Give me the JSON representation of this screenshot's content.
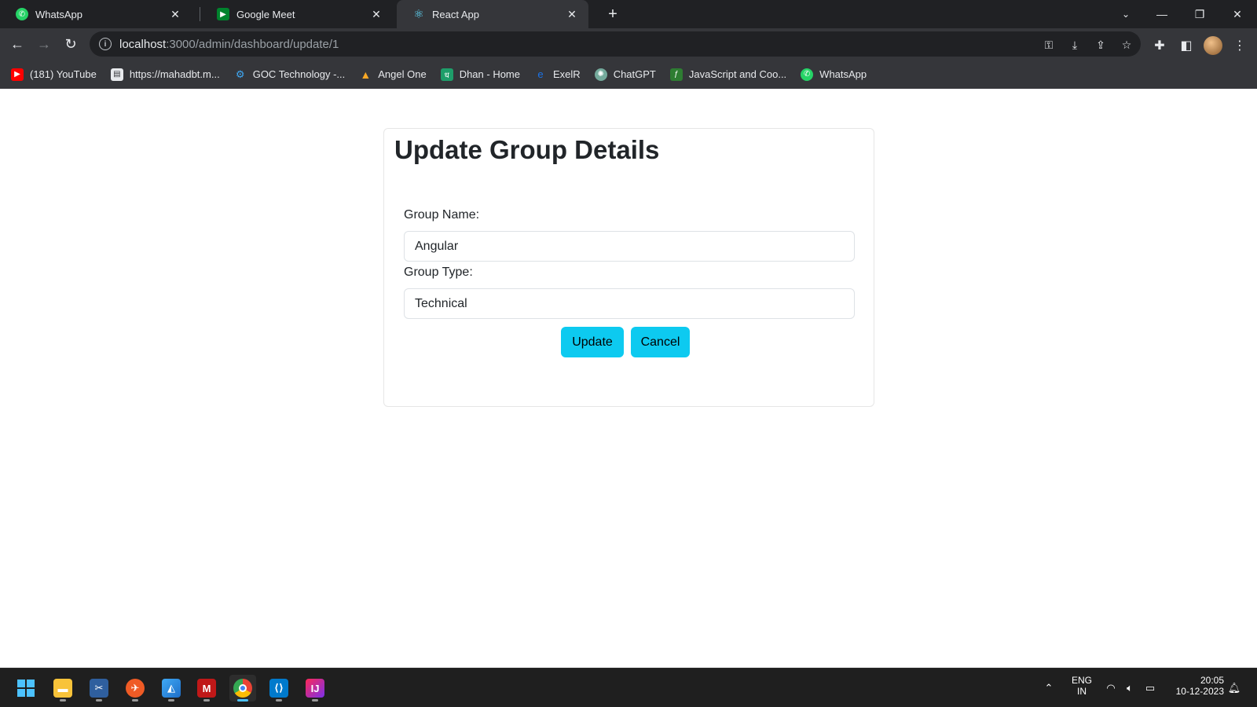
{
  "browser": {
    "tabs": [
      {
        "label": "WhatsApp",
        "icon": "whatsapp-icon",
        "color": "#25d366"
      },
      {
        "label": "Google Meet",
        "icon": "google-meet-icon",
        "color": "#00832d"
      },
      {
        "label": "React App",
        "icon": "react-icon",
        "color": "#61dafb"
      }
    ],
    "url_host": "localhost",
    "url_path": ":3000/admin/dashboard/update/1",
    "bookmarks": [
      {
        "label": "(181) YouTube",
        "icon": "youtube-icon",
        "color": "#ff0000"
      },
      {
        "label": "https://mahadbt.m...",
        "icon": "page-icon",
        "color": "#e8eaed"
      },
      {
        "label": "GOC Technology -...",
        "icon": "goc-icon",
        "color": "#3fa9f5"
      },
      {
        "label": "Angel One",
        "icon": "angel-one-icon",
        "color": "#2e7d32"
      },
      {
        "label": "Dhan - Home",
        "icon": "dhan-icon",
        "color": "#1e9e6a"
      },
      {
        "label": "ExelR",
        "icon": "exelr-icon",
        "color": "#1a73e8"
      },
      {
        "label": "ChatGPT",
        "icon": "chatgpt-icon",
        "color": "#74aa9c"
      },
      {
        "label": "JavaScript and Coo...",
        "icon": "freecodecamp-icon",
        "color": "#2e7d32"
      },
      {
        "label": "WhatsApp",
        "icon": "whatsapp-icon",
        "color": "#25d366"
      }
    ]
  },
  "form": {
    "title": "Update Group Details",
    "group_name_label": "Group Name:",
    "group_name_value": "Angular",
    "group_type_label": "Group Type:",
    "group_type_value": "Technical",
    "update_label": "Update",
    "cancel_label": "Cancel",
    "accent_color": "#0dcaf0"
  },
  "taskbar": {
    "apps": [
      {
        "icon": "windows-start-icon"
      },
      {
        "icon": "file-explorer-icon"
      },
      {
        "icon": "snipping-tool-icon"
      },
      {
        "icon": "postman-icon"
      },
      {
        "icon": "photos-icon"
      },
      {
        "icon": "mcafee-icon"
      },
      {
        "icon": "chrome-icon"
      },
      {
        "icon": "vscode-icon"
      },
      {
        "icon": "intellij-icon"
      }
    ],
    "lang_top": "ENG",
    "lang_bottom": "IN",
    "time": "20:05",
    "date": "10-12-2023"
  }
}
